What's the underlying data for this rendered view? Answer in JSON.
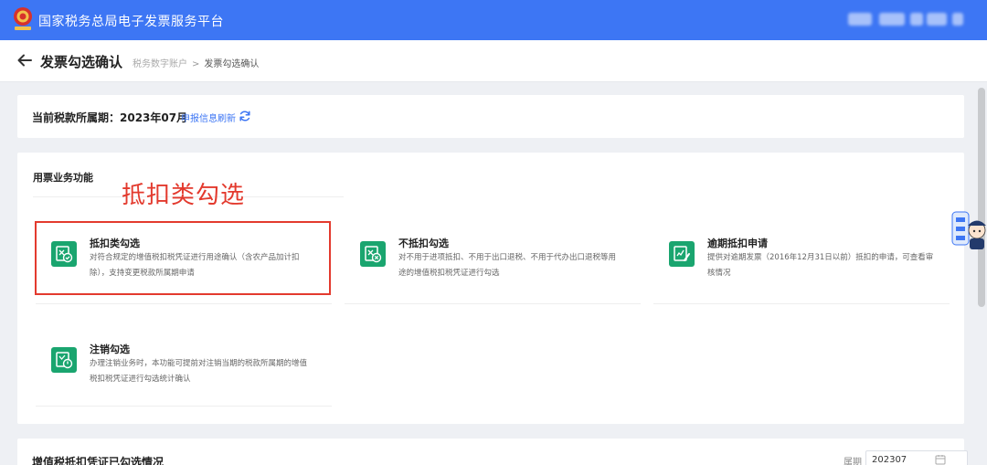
{
  "app": {
    "title": "国家税务总局电子发票服务平台"
  },
  "colors": {
    "brand": "#3d76f4",
    "icon_green": "#1aa56f",
    "annotation_red": "#e33a2e"
  },
  "header": {
    "page_title": "发票勾选确认",
    "breadcrumb": {
      "parent": "税务数字账户",
      "separator": ">",
      "current": "发票勾选确认"
    }
  },
  "period": {
    "label": "当前税款所属期：2023年07月",
    "refresh_text": "申报信息刷新"
  },
  "functions": {
    "section_title": "用票业务功能",
    "annotation": "抵扣类勾选",
    "items": [
      {
        "name": "抵扣类勾选",
        "icon": "invoice-check-icon",
        "desc_line1": "对符合规定的增值税扣税凭证进行用途确认（含农产品加计扣",
        "desc_line2": "除），支持变更税款所属期申请"
      },
      {
        "name": "不抵扣勾选",
        "icon": "invoice-cancel-icon",
        "desc_line1": "对不用于进项抵扣、不用于出口退税、不用于代办出口退税等用",
        "desc_line2": "途的增值税扣税凭证进行勾选"
      },
      {
        "name": "逾期抵扣申请",
        "icon": "overdue-apply-icon",
        "desc_line1": "提供对逾期发票（2016年12月31日以前）抵扣的申请，可查看审",
        "desc_line2": "核情况"
      },
      {
        "name": "注销勾选",
        "icon": "deregister-select-icon",
        "desc_line1": "办理注销业务时，本功能可提前对注销当期的税款所属期的增值",
        "desc_line2": "税扣税凭证进行勾选统计确认"
      }
    ]
  },
  "bottom": {
    "title": "增值税抵扣凭证已勾选情况",
    "period_label": "属期",
    "period_value": "202307"
  }
}
